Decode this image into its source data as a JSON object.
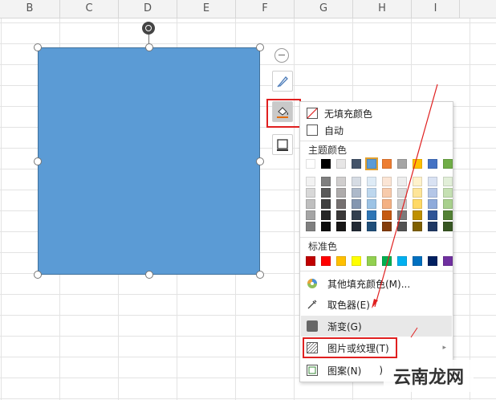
{
  "columns": [
    "B",
    "C",
    "D",
    "E",
    "F",
    "G",
    "H",
    "I"
  ],
  "toolbar_icons": [
    "minus-icon",
    "brush-icon",
    "fill-bucket-icon",
    "outline-icon"
  ],
  "menu": {
    "no_fill": "无填充颜色",
    "auto": "自动",
    "theme_colors_title": "主题颜色",
    "theme_top_row": [
      "#ffffff",
      "#000000",
      "#e7e6e6",
      "#44546a",
      "#5b9bd5",
      "#ed7d31",
      "#a5a5a5",
      "#ffc000",
      "#4472c4",
      "#70ad47"
    ],
    "theme_shades": [
      [
        "#f2f2f2",
        "#7f7f7f",
        "#d0cece",
        "#d6dce4",
        "#deebf6",
        "#fbe5d5",
        "#ededed",
        "#fff2cc",
        "#d9e2f3",
        "#e2efd9"
      ],
      [
        "#d8d8d8",
        "#595959",
        "#aeabab",
        "#adb9ca",
        "#bdd7ee",
        "#f7cbac",
        "#dbdbdb",
        "#fee599",
        "#b4c6e7",
        "#c5e0b3"
      ],
      [
        "#bfbfbf",
        "#3f3f3f",
        "#757070",
        "#8496b0",
        "#9cc3e5",
        "#f4b183",
        "#c9c9c9",
        "#ffd965",
        "#8eaadb",
        "#a8d08d"
      ],
      [
        "#a5a5a5",
        "#262626",
        "#3a3838",
        "#323f4f",
        "#2e75b5",
        "#c55a11",
        "#7b7b7b",
        "#bf9000",
        "#2f5496",
        "#538135"
      ],
      [
        "#7f7f7f",
        "#0c0c0c",
        "#171616",
        "#222a35",
        "#1f4e79",
        "#833c0b",
        "#525252",
        "#7f6000",
        "#1f3864",
        "#375623"
      ]
    ],
    "standard_colors_title": "标准色",
    "standard_colors": [
      "#c00000",
      "#ff0000",
      "#ffc000",
      "#ffff00",
      "#92d050",
      "#00b050",
      "#00b0f0",
      "#0070c0",
      "#002060",
      "#7030a0"
    ],
    "more_fill": "其他填充颜色(M)...",
    "eyedropper": "取色器(E)",
    "gradient": "渐变(G)",
    "picture_texture": "图片或纹理(T)",
    "pattern": "图案(N)",
    "pattern_suffix": ")"
  },
  "watermark": "云南龙网",
  "colors": {
    "shape_fill": "#5b9bd5",
    "highlight_red": "#e02020"
  }
}
